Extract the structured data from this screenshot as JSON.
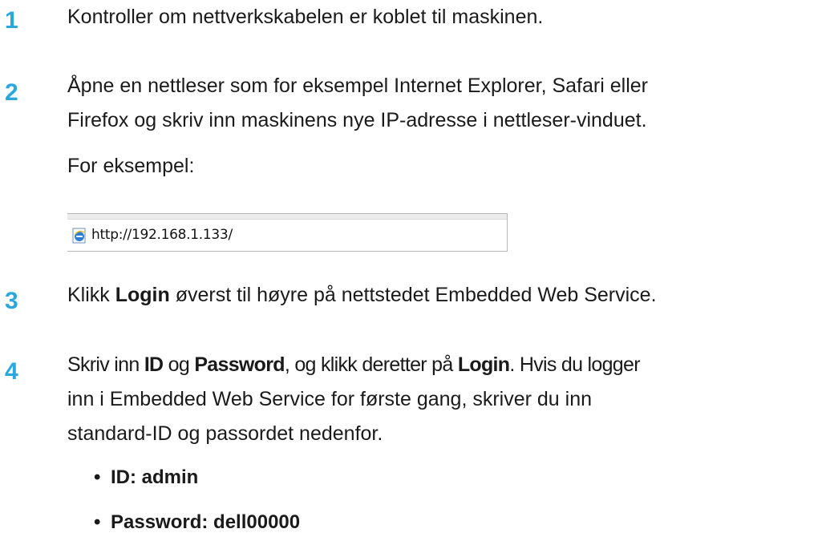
{
  "steps": [
    {
      "number": "1",
      "lines": [
        "Kontroller om nettverkskabelen er koblet til maskinen."
      ]
    },
    {
      "number": "2",
      "lines": [
        "Åpne en nettleser som for eksempel Internet Explorer, Safari eller",
        "Firefox og skriv inn maskinens nye IP-adresse i nettleser-vinduet."
      ],
      "example_label": "For eksempel:",
      "address_bar": {
        "icon": "ie-page-icon",
        "url": "http://192.168.1.133/"
      }
    },
    {
      "number": "3",
      "text_before": "Klikk ",
      "bold": "Login",
      "text_after": " øverst til høyre på nettstedet Embedded Web Service."
    },
    {
      "number": "4",
      "line1": {
        "t1": "Skriv inn ",
        "b1": "ID",
        "t2": " og ",
        "b2": "Password",
        "t3": ", og klikk deretter på ",
        "b3": "Login",
        "t4": ". Hvis du logger"
      },
      "line2": "inn i Embedded Web Service for første gang, skriver du inn",
      "line3": "standard-ID og passordet nedenfor.",
      "bullets": [
        {
          "symbol": "•",
          "text": "ID: admin"
        },
        {
          "symbol": "•",
          "text": "Password: dell00000"
        }
      ]
    }
  ],
  "colors": {
    "step_number": "#29a8df",
    "text": "#1a1a1a"
  }
}
